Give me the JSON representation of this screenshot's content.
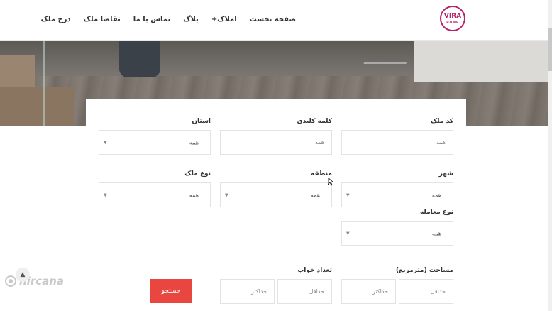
{
  "header": {
    "logo": {
      "text": "VIRA",
      "sub": "HOME"
    },
    "nav": [
      "صفحه نخست",
      "+املاک",
      "بلاگ",
      "تماس با ما",
      "تقاضا ملک",
      "درج ملک"
    ]
  },
  "search": {
    "property_code": {
      "label": "کد ملک",
      "placeholder": "همه"
    },
    "keyword": {
      "label": "کلمه کلیدی",
      "placeholder": "همه"
    },
    "province": {
      "label": "استان",
      "value": "همه"
    },
    "city": {
      "label": "شهر",
      "value": "همه"
    },
    "region": {
      "label": "منطقه",
      "value": "همه"
    },
    "property_type": {
      "label": "نوع ملک",
      "value": "همه"
    },
    "deal_type": {
      "label": "نوع معامله",
      "value": "همه"
    },
    "area": {
      "label": "مساحت (مترمربع)",
      "min_placeholder": "حداقل",
      "max_placeholder": "حداکثر"
    },
    "bedrooms": {
      "label": "تعداد خواب",
      "min_placeholder": "حداقل",
      "max_placeholder": "حداکثر"
    },
    "submit": "جستجو"
  },
  "watermark": {
    "text": "hircana"
  },
  "colors": {
    "accent": "#e8463e",
    "logo": "#b5236b"
  }
}
